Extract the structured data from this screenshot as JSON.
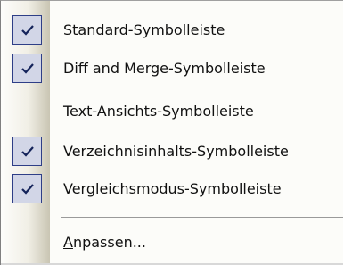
{
  "menu": {
    "items": [
      {
        "label": "Standard-Symbolleiste",
        "checked": true
      },
      {
        "label": "Diff and Merge-Symbolleiste",
        "checked": true
      },
      {
        "label": "Text-Ansichts-Symbolleiste",
        "checked": false
      },
      {
        "label": "Verzeichnisinhalts-Symbolleiste",
        "checked": true
      },
      {
        "label": "Vergleichsmodus-Symbolleiste",
        "checked": true
      }
    ],
    "customize": {
      "mnemonic": "A",
      "rest": "npassen..."
    },
    "icons": {
      "check": "checkmark-icon"
    },
    "colors": {
      "check_box_border": "#2e3e87",
      "check_box_fill": "#d2d6e7",
      "check_mark": "#14235a",
      "menu_background": "#fcfcf9"
    }
  }
}
